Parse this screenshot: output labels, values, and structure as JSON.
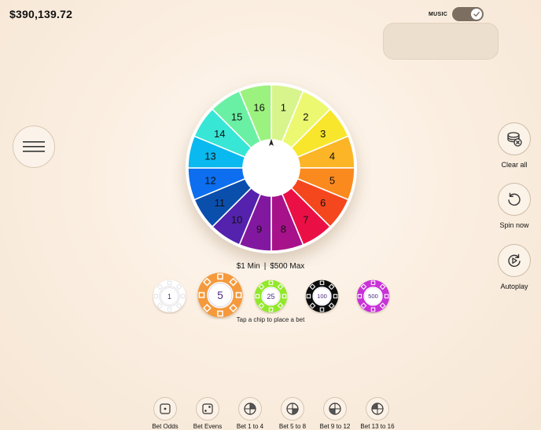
{
  "header": {
    "balance": "$390,139.72"
  },
  "music": {
    "label": "MUSIC",
    "enabled": true
  },
  "wheel": {
    "segments": [
      {
        "number": "1",
        "color": "#d7f58c"
      },
      {
        "number": "2",
        "color": "#ecf870"
      },
      {
        "number": "3",
        "color": "#f8e62c"
      },
      {
        "number": "4",
        "color": "#fbb526"
      },
      {
        "number": "5",
        "color": "#fb8a1e"
      },
      {
        "number": "6",
        "color": "#f4471e"
      },
      {
        "number": "7",
        "color": "#ea1046"
      },
      {
        "number": "8",
        "color": "#a7128a"
      },
      {
        "number": "9",
        "color": "#8318a0"
      },
      {
        "number": "10",
        "color": "#5422ad"
      },
      {
        "number": "11",
        "color": "#0b4fad"
      },
      {
        "number": "12",
        "color": "#0d6ff0"
      },
      {
        "number": "13",
        "color": "#0ab9f0"
      },
      {
        "number": "14",
        "color": "#38e6d6"
      },
      {
        "number": "15",
        "color": "#6af0a4"
      },
      {
        "number": "16",
        "color": "#9cf27e"
      }
    ]
  },
  "limits": {
    "min": "$1 Min",
    "separator": "|",
    "max": "$500 Max"
  },
  "chips": [
    {
      "value": "1",
      "color": "#ffffff",
      "accent": "#e6e6e6",
      "text_color": "#4b2a80",
      "selected": false
    },
    {
      "value": "5",
      "color": "#f49a3c",
      "accent": "#ffffff",
      "text_color": "#4b2a80",
      "selected": true
    },
    {
      "value": "25",
      "color": "#92e82a",
      "accent": "#ffffff",
      "text_color": "#4b2a80",
      "selected": false
    },
    {
      "value": "100",
      "color": "#111111",
      "accent": "#ffffff",
      "text_color": "#4b2a80",
      "selected": false
    },
    {
      "value": "500",
      "color": "#c832d6",
      "accent": "#ffffff",
      "text_color": "#4b2a80",
      "selected": false
    }
  ],
  "chip_hint": "Tap a chip to place a bet",
  "actions": {
    "clear_all": "Clear all",
    "spin_now": "Spin now",
    "autoplay": "Autoplay"
  },
  "bets": [
    {
      "label": "Bet Odds",
      "icon": "die-one-icon"
    },
    {
      "label": "Bet Evens",
      "icon": "die-two-icon"
    },
    {
      "label": "Bet 1 to 4",
      "icon": "quarter-1-icon"
    },
    {
      "label": "Bet 5 to 8",
      "icon": "quarter-2-icon"
    },
    {
      "label": "Bet 9 to 12",
      "icon": "quarter-3-icon"
    },
    {
      "label": "Bet 13 to 16",
      "icon": "quarter-4-icon"
    }
  ]
}
